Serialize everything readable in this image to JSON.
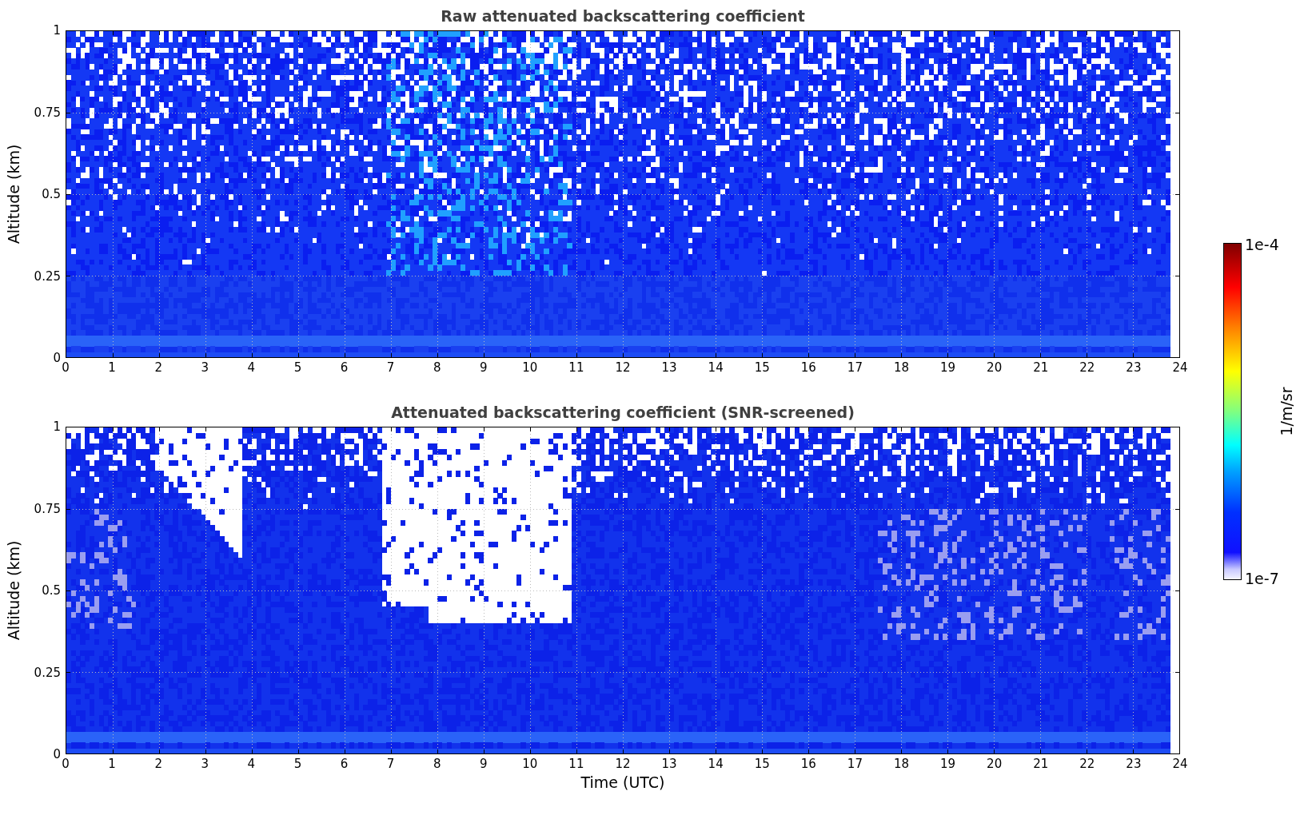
{
  "panels": [
    {
      "title": "Raw attenuated backscattering coefficient",
      "ylabel": "Altitude (km)",
      "yticks": [
        "1",
        "0.75",
        "0.5",
        "0.25",
        "0"
      ],
      "xticks": [
        "0",
        "1",
        "2",
        "3",
        "4",
        "5",
        "6",
        "7",
        "8",
        "9",
        "10",
        "11",
        "12",
        "13",
        "14",
        "15",
        "16",
        "17",
        "18",
        "19",
        "20",
        "21",
        "22",
        "23",
        "24"
      ],
      "kind": "raw"
    },
    {
      "title": "Attenuated backscattering coefficient (SNR-screened)",
      "ylabel": "Altitude (km)",
      "yticks": [
        "1",
        "0.75",
        "0.5",
        "0.25",
        "0"
      ],
      "xticks": [
        "0",
        "1",
        "2",
        "3",
        "4",
        "5",
        "6",
        "7",
        "8",
        "9",
        "10",
        "11",
        "12",
        "13",
        "14",
        "15",
        "16",
        "17",
        "18",
        "19",
        "20",
        "21",
        "22",
        "23",
        "24"
      ],
      "xlabel": "Time (UTC)",
      "kind": "screened"
    }
  ],
  "colorbar": {
    "label": "1/m/sr",
    "max": "1e-4",
    "min": "1e-7"
  }
}
